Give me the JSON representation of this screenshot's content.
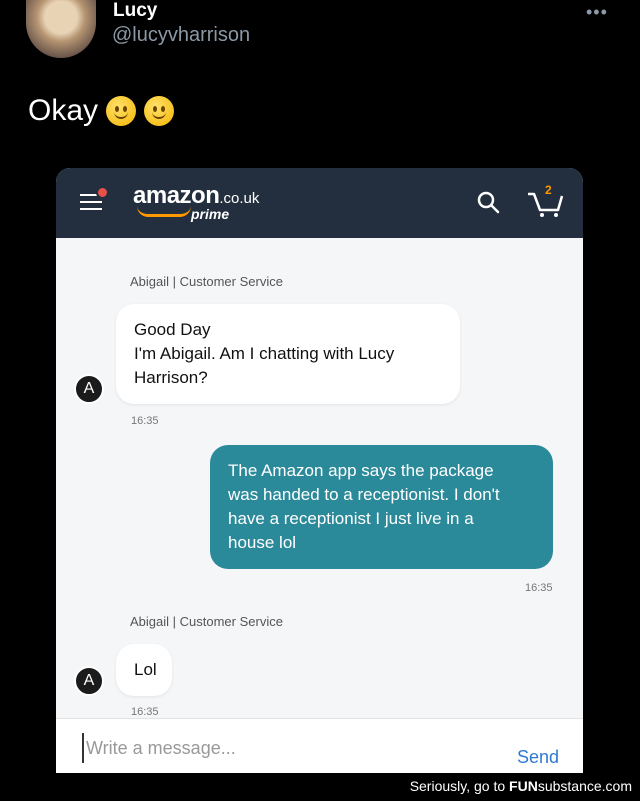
{
  "tweet": {
    "name": "Lucy",
    "handle": "@lucyvharrison",
    "text": "Okay",
    "more_icon": "ellipsis-icon"
  },
  "app": {
    "logo_word": "amazon",
    "logo_tld": ".co.uk",
    "logo_prime": "prime",
    "cart_count": "2",
    "accent": "#ff9900",
    "header_color": "#232f3e"
  },
  "chat": {
    "messages": [
      {
        "sender": "Abigail | Customer Service",
        "avatar": "A",
        "lines": [
          "Good Day",
          "I'm Abigail. Am I chatting with Lucy",
          "Harrison?"
        ],
        "time": "16:35"
      },
      {
        "lines": [
          "The Amazon app says the package",
          "was handed to a receptionist. I don't",
          "have a receptionist I just live in a",
          "house lol"
        ],
        "time": "16:35"
      },
      {
        "sender": "Abigail | Customer Service",
        "avatar": "A",
        "lines": [
          "Lol"
        ],
        "time": "16:35"
      }
    ],
    "composer_placeholder": "Write a message...",
    "send_label": "Send",
    "outgoing_color": "#2b8a9a"
  },
  "watermark": {
    "prefix": "Seriously, go to ",
    "brand_a": "FUN",
    "brand_b": "substance",
    "suffix": ".com"
  }
}
